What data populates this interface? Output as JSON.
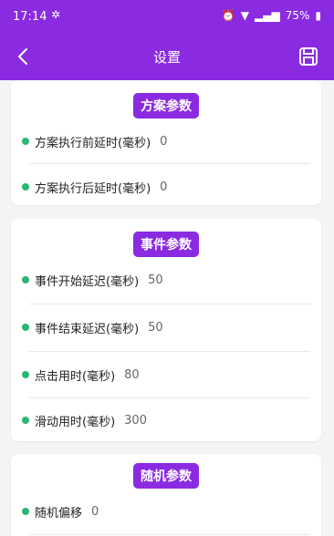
{
  "status_bar": {
    "time": "17:14",
    "battery": "75%"
  },
  "header": {
    "title": "设置",
    "back_icon": "back-arrow-icon",
    "save_icon": "save-icon"
  },
  "sections": [
    {
      "title": "方案参数",
      "items": [
        {
          "label": "方案执行前延时(毫秒)",
          "value": "0"
        },
        {
          "label": "方案执行后延时(毫秒)",
          "value": "0"
        }
      ]
    },
    {
      "title": "事件参数",
      "items": [
        {
          "label": "事件开始延迟(毫秒)",
          "value": "50"
        },
        {
          "label": "事件结束延迟(毫秒)",
          "value": "50"
        },
        {
          "label": "点击用时(毫秒)",
          "value": "80"
        },
        {
          "label": "滑动用时(毫秒)",
          "value": "300"
        }
      ]
    },
    {
      "title": "随机参数",
      "items": [
        {
          "label": "随机偏移",
          "value": "0"
        }
      ]
    }
  ],
  "colors": {
    "accent": "#8a2be2",
    "dot": "#2bb673"
  }
}
